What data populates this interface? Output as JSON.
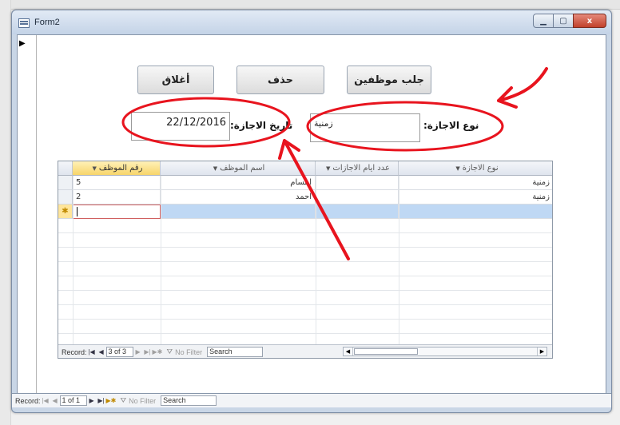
{
  "window": {
    "title": "Form2",
    "min_icon": "minimize-icon",
    "max_icon": "maximize-icon",
    "close_label": "x"
  },
  "form": {
    "record_selector": "▶",
    "buttons": {
      "close": "أغلاق",
      "delete": "حذف",
      "fetch_employees": "جلب موظفين"
    },
    "vacation_date_label": "تاريخ الاجازة:",
    "vacation_date_value": "22/12/2016",
    "vacation_type_label": "نوع الاجازة:",
    "vacation_type_value": "زمنية"
  },
  "subform": {
    "columns": [
      {
        "label": "رقم الموظف",
        "arrow": "▼"
      },
      {
        "label": "اسم الموظف",
        "arrow": "▼"
      },
      {
        "label": "عدد ايام الاجازات",
        "arrow": "▼"
      },
      {
        "label": "نوع الاجازة",
        "arrow": "▼"
      }
    ],
    "rows": [
      {
        "emp_no": "5",
        "emp_name": "ابتسام",
        "days": "",
        "type": "زمنية"
      },
      {
        "emp_no": "2",
        "emp_name": "احمد",
        "days": "",
        "type": "زمنية"
      }
    ],
    "new_row_marker": "✱",
    "nav": {
      "record_label": "Record:",
      "position": "3 of 3",
      "filter_label": "No Filter",
      "search_value": "Search"
    }
  },
  "main_nav": {
    "record_label": "Record:",
    "position": "1 of 1",
    "filter_label": "No Filter",
    "search_value": "Search"
  },
  "annotations": {
    "color": "#e8141e"
  }
}
